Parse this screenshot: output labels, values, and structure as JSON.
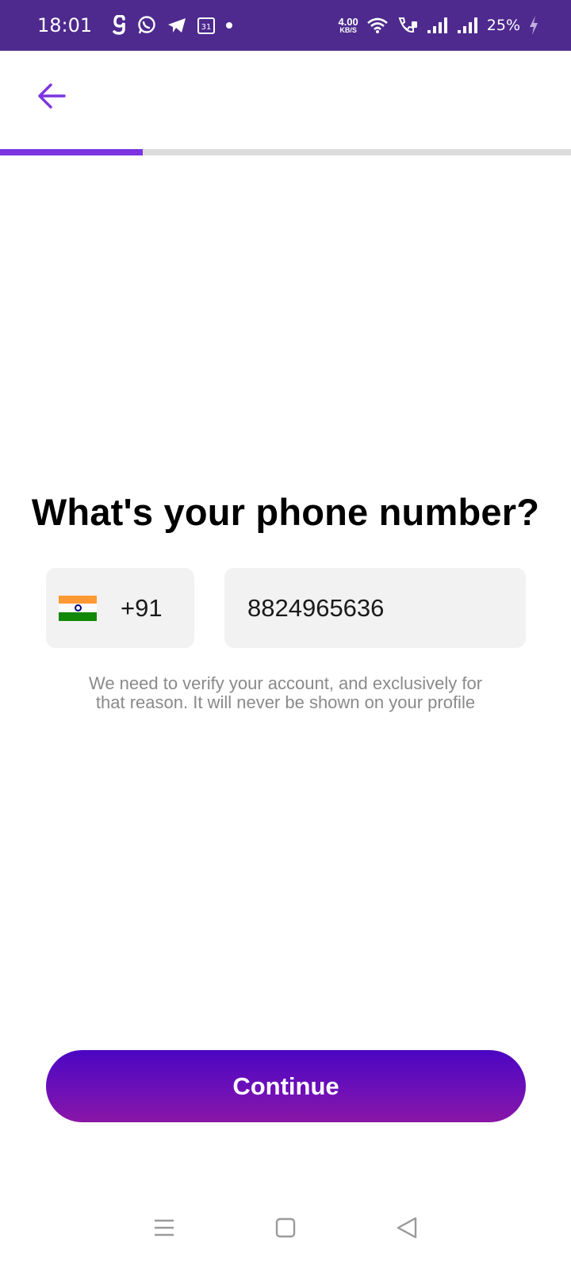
{
  "status_bar": {
    "time": "18:01",
    "calendar_day": "31",
    "net_speed_value": "4.00",
    "net_speed_unit": "KB/S",
    "battery": "25%",
    "left_icons": [
      "g-app-icon",
      "whatsapp-icon",
      "telegram-icon",
      "calendar-icon",
      "dot-icon"
    ],
    "right_icons": [
      "wifi-icon",
      "wifi-calling-icon",
      "signal-icon",
      "signal-icon",
      "battery-charging-icon"
    ]
  },
  "header": {
    "back_icon": "arrow-left-icon",
    "progress": 0.25
  },
  "main": {
    "title": "What's your phone number?",
    "country": {
      "flag_icon": "india-flag-icon",
      "code": "+91"
    },
    "phone": {
      "value": "8824965636"
    },
    "hint_line1": "We need to verify your account, and exclusively for",
    "hint_line2": "that reason. It will never be shown on your profile",
    "continue_label": "Continue"
  },
  "nav_bar": {
    "icons": [
      "menu-icon",
      "home-square-icon",
      "back-triangle-icon"
    ]
  },
  "colors": {
    "status_bar": "#4e2a8e",
    "accent": "#7b34e0",
    "button_top": "#4a06c2",
    "button_bottom": "#8a16a6",
    "input_bg": "#f2f2f2",
    "hint_text": "#8a8a8a"
  }
}
